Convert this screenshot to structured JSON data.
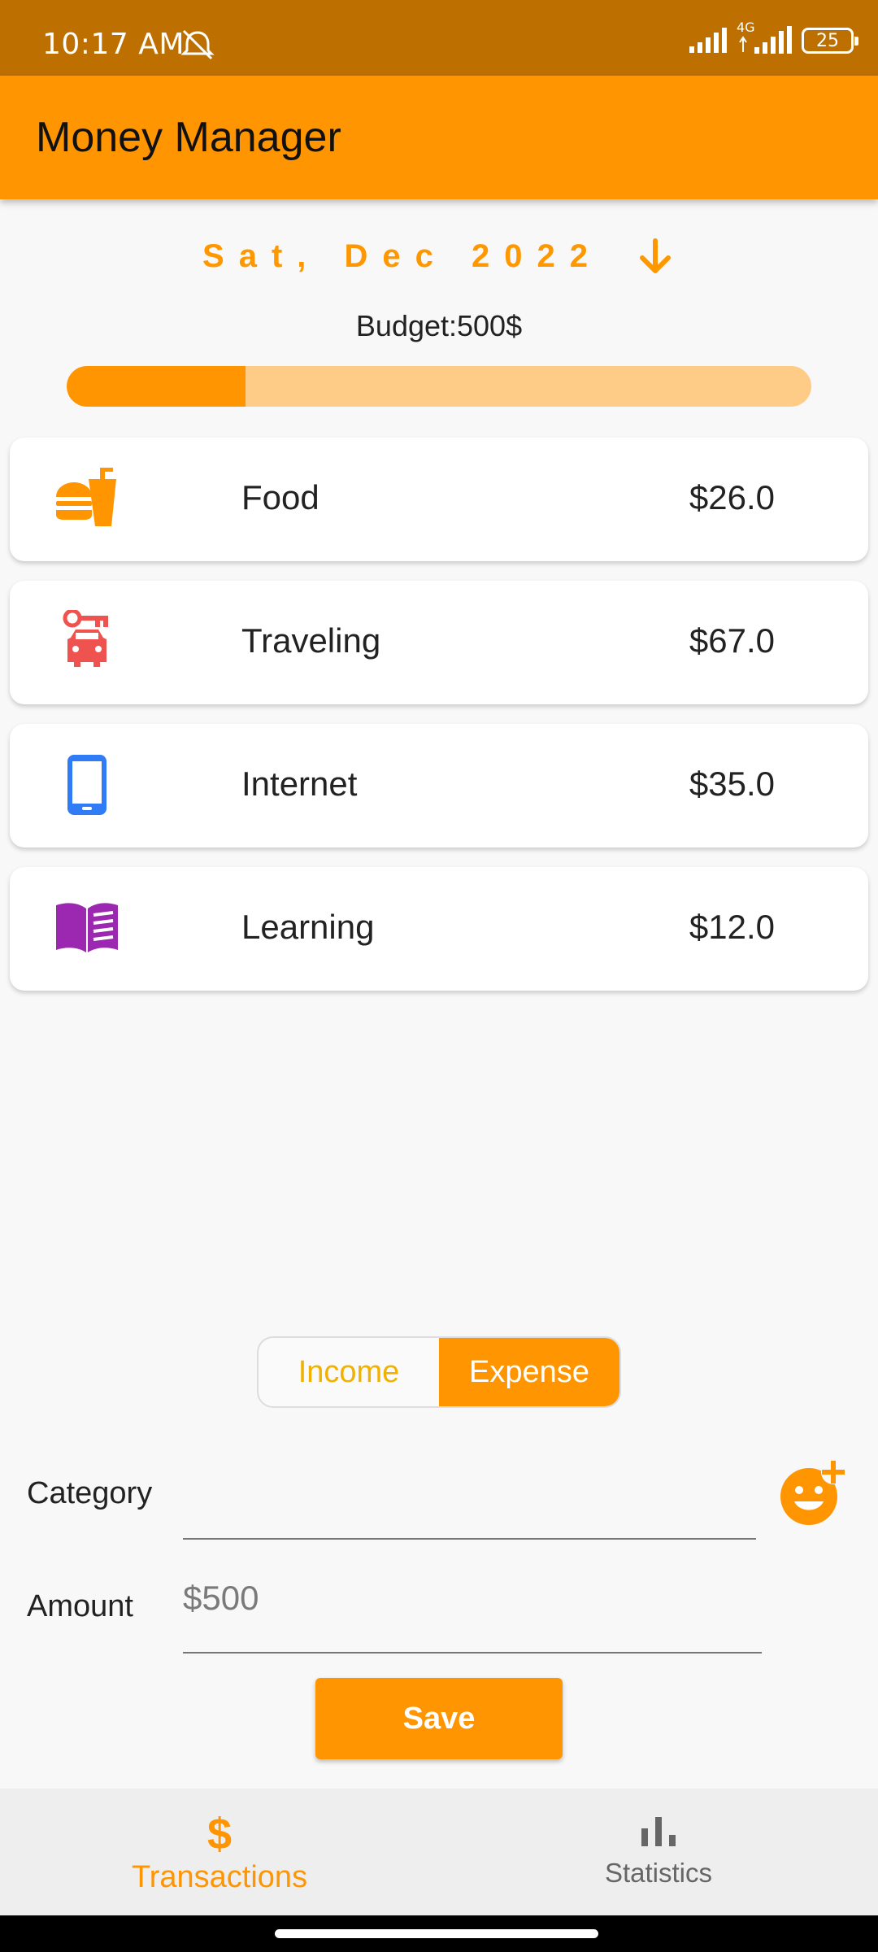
{
  "status_bar": {
    "time": "10:17 AM",
    "network": "4G",
    "battery": "25"
  },
  "app_bar": {
    "title": "Money Manager"
  },
  "date_selector": {
    "label": "Sat, Dec 2022"
  },
  "budget": {
    "label": "Budget:500$",
    "progress_fraction": 0.24
  },
  "categories": [
    {
      "name": "Food",
      "amount": "$26.0",
      "icon": "fastfood-icon",
      "color": "#ff9500"
    },
    {
      "name": "Traveling",
      "amount": "$67.0",
      "icon": "car-rental-icon",
      "color": "#ef5350"
    },
    {
      "name": "Internet",
      "amount": "$35.0",
      "icon": "smartphone-icon",
      "color": "#2f7cf6"
    },
    {
      "name": "Learning",
      "amount": "$12.0",
      "icon": "book-icon",
      "color": "#9c27b0"
    }
  ],
  "toggle": {
    "income_label": "Income",
    "expense_label": "Expense",
    "selected": "Expense"
  },
  "form": {
    "category_label": "Category",
    "category_value": "",
    "amount_label": "Amount",
    "amount_placeholder": "$500"
  },
  "save_label": "Save",
  "bottom_nav": {
    "transactions_label": "Transactions",
    "statistics_label": "Statistics",
    "active": "Transactions"
  },
  "colors": {
    "accent": "#ff9500",
    "status_bar": "#bd6f00",
    "progress_track": "#ffcc88"
  }
}
